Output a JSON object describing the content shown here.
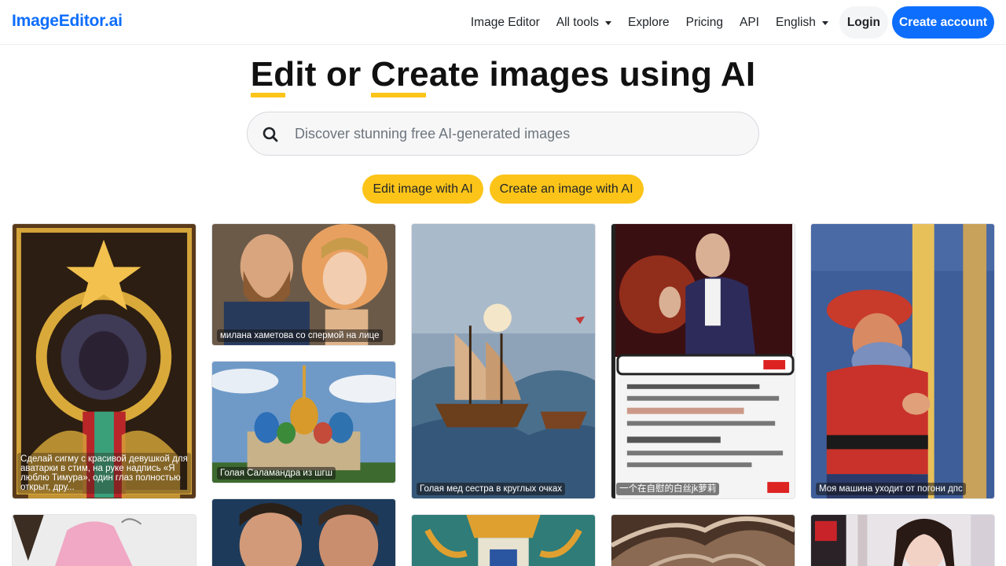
{
  "brand": "ImageEditor.ai",
  "nav": {
    "items": [
      {
        "label": "Image Editor",
        "dropdown": false
      },
      {
        "label": "All tools",
        "dropdown": true
      },
      {
        "label": "Explore",
        "dropdown": false
      },
      {
        "label": "Pricing",
        "dropdown": false
      },
      {
        "label": "API",
        "dropdown": false
      },
      {
        "label": "English",
        "dropdown": true
      }
    ],
    "login": "Login",
    "create_account": "Create account"
  },
  "hero": {
    "title_part1": "Edit",
    "title_part2": " or ",
    "title_part3": "Create",
    "title_part4": " images using AI"
  },
  "search": {
    "placeholder": "Discover stunning free AI-generated images",
    "value": ""
  },
  "cta": {
    "edit": "Edit image with AI",
    "create": "Create an image with AI"
  },
  "gallery": {
    "captions": [
      "Сделай сигму с красивой девушкой для аватарки в стим, на руке надпись «Я люблю Тимура», один глаз полностью открыт, дру...",
      "милана хаметова со спермой на лице",
      "Голая Саламандра из шгш",
      "Голая мед сестра в круглых очках",
      "一个在自慰的白丝jk萝莉",
      "Моя машина уходит от погони дпс"
    ]
  },
  "colors": {
    "brand": "#0d6efd",
    "accent_yellow": "#fcc419"
  }
}
